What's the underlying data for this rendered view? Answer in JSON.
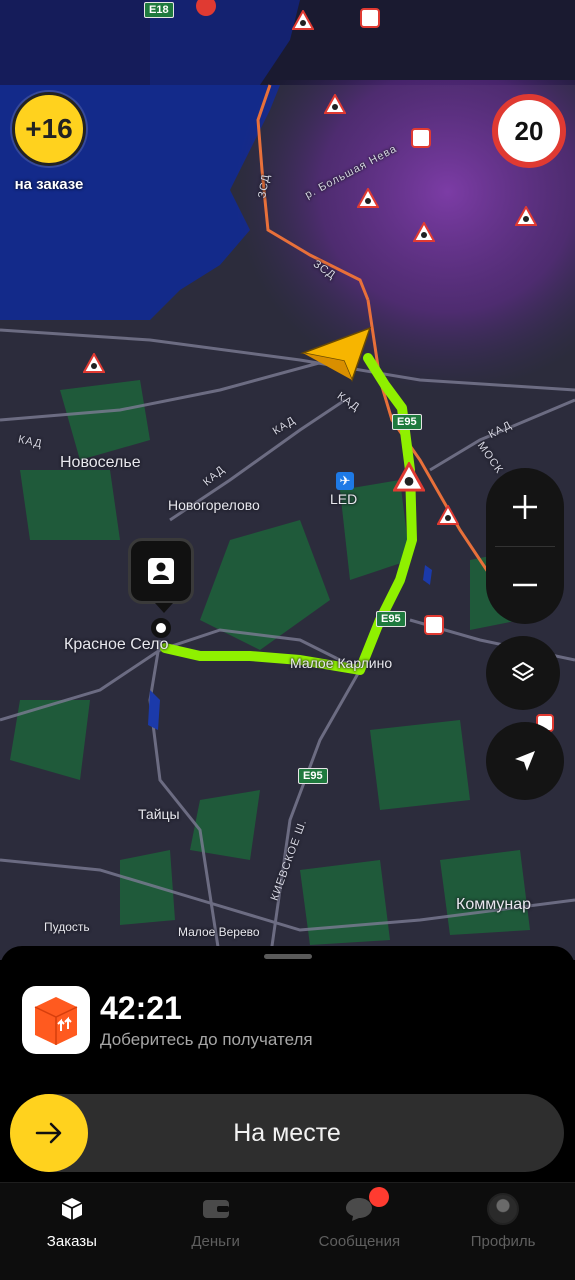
{
  "map": {
    "bonus_value": "+16",
    "bonus_caption": "на заказе",
    "speed_limit": "20",
    "labels": {
      "novoselye": "Новоселье",
      "novogorelovo": "Новогорелово",
      "krasnoe_selo": "Красное Село",
      "maloe_karlino": "Малое Карлино",
      "taitsy": "Тайцы",
      "pudost": "Пудость",
      "maloe_verevo": "Малое Верево",
      "kommunar": "Коммунар",
      "led": "LED",
      "bolshaya_neva": "р. Большая Нева",
      "kievskoe": "КИЕВСКОЕ Ш.",
      "kad": "КАД",
      "zsd": "ЗСД",
      "mosk": "МОСК"
    },
    "shields": {
      "e95": "E95",
      "e18": "E18"
    }
  },
  "controls": {
    "zoom_in_icon": "plus-icon",
    "zoom_out_icon": "minus-icon",
    "layers_icon": "layers-icon",
    "locate_icon": "navigation-arrow-icon"
  },
  "order": {
    "icon": "parcel-box-icon",
    "eta": "42:21",
    "instruction": "Доберитесь до получателя"
  },
  "slider": {
    "label": "На месте",
    "icon": "arrow-right-icon"
  },
  "tabs": [
    {
      "label": "Заказы",
      "icon": "box-icon",
      "active": true
    },
    {
      "label": "Деньги",
      "icon": "wallet-icon",
      "active": false
    },
    {
      "label": "Сообщения",
      "icon": "chat-icon",
      "active": false
    },
    {
      "label": "Профиль",
      "icon": "avatar-icon",
      "active": false
    }
  ],
  "colors": {
    "accent_yellow": "#ffd21e",
    "route_green": "#8ff000",
    "speed_red": "#e03a32",
    "badge_red": "#ff3b30",
    "traffic_purple": "#7a3aa8"
  }
}
